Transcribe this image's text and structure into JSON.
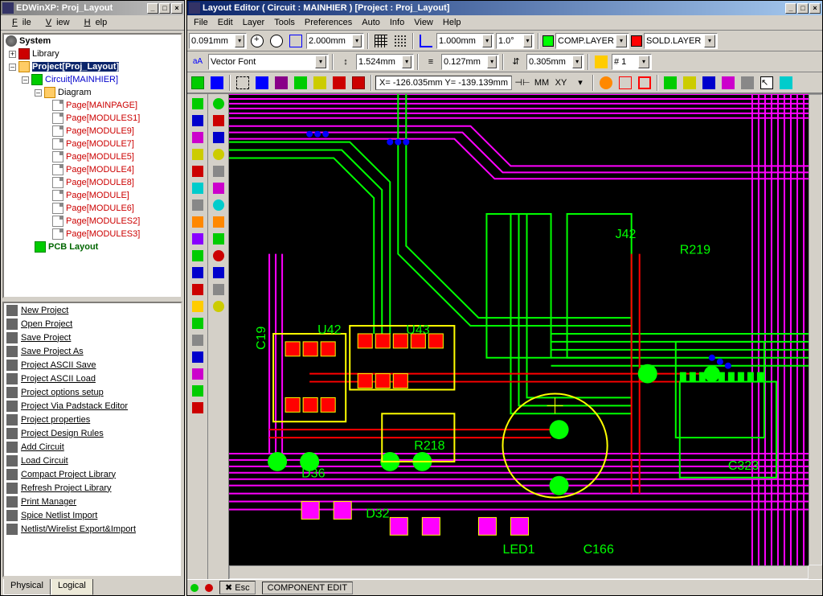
{
  "left_window": {
    "title": "EDWinXP: Proj_Layout",
    "menu": [
      "File",
      "View",
      "Help"
    ],
    "tree": {
      "root": "System",
      "library": "Library",
      "project": "Project[Proj_Layout]",
      "circuit": "Circuit[MAINHIER]",
      "diagram": "Diagram",
      "pages": [
        "Page[MAINPAGE]",
        "Page[MODULES1]",
        "Page[MODULE9]",
        "Page[MODULE7]",
        "Page[MODULE5]",
        "Page[MODULE4]",
        "Page[MODULE8]",
        "Page[MODULE]",
        "Page[MODULE6]",
        "Page[MODULES2]",
        "Page[MODULES3]"
      ],
      "pcb": "PCB Layout"
    },
    "actions": [
      "New Project",
      "Open Project",
      "Save Project",
      "Save Project As",
      "Project ASCII Save",
      "Project ASCII Load",
      "Project options setup",
      "Project Via Padstack Editor",
      "Project properties",
      "Project Design Rules",
      "Add Circuit",
      "Load Circuit",
      "Compact Project Library",
      "Refresh Project Library",
      "Print Manager",
      "Spice Netlist Import",
      "Netlist/Wirelist Export&Import"
    ],
    "tabs": {
      "physical": "Physical",
      "logical": "Logical"
    }
  },
  "right_window": {
    "title": "Layout Editor ( Circuit : MAINHIER ) [Project : Proj_Layout]",
    "menu": [
      "File",
      "Edit",
      "Layer",
      "Tools",
      "Preferences",
      "Auto",
      "Info",
      "View",
      "Help"
    ],
    "toolbar1": {
      "size1": "0.091mm",
      "size2": "2.000mm",
      "size3": "1.000mm",
      "angle": "1.0°",
      "layer1": {
        "name": "COMP.LAYER",
        "color": "#00ff00"
      },
      "layer2": {
        "name": "SOLD.LAYER",
        "color": "#ff0000"
      }
    },
    "toolbar2": {
      "font": "Vector Font",
      "val1": "1.524mm",
      "val2": "0.127mm",
      "val3": "0.305mm",
      "hash": "# 1"
    },
    "toolbar3": {
      "coords": "X= -126.035mm Y= -139.139mm",
      "unit": "MM",
      "mode": "XY"
    },
    "status": {
      "esc": "Esc",
      "mode": "COMPONENT EDIT"
    },
    "silk_texts": [
      "J42",
      "R219",
      "C19",
      "U42",
      "U43",
      "D36",
      "D32",
      "R218",
      "LED1",
      "C166",
      "C323"
    ]
  }
}
